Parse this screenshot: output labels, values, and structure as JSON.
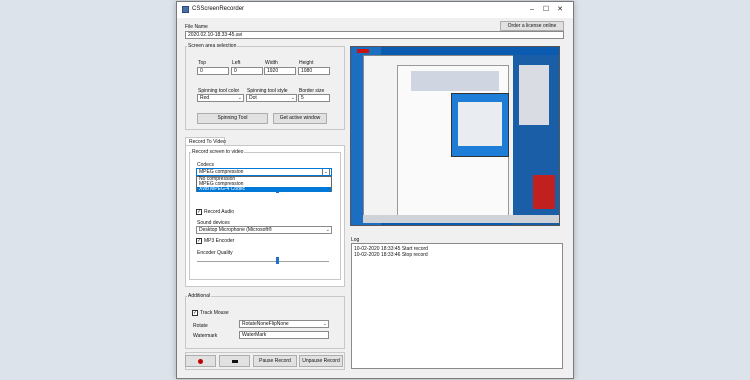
{
  "window": {
    "title": "CSScreenRecorder",
    "controls": {
      "minimize": "–",
      "maximize": "☐",
      "close": "✕"
    }
  },
  "file_name": {
    "label": "File Name",
    "value": "2020.02.10-18.33-45.avi",
    "order_button": "Order a license online"
  },
  "screen_area": {
    "group_label": "Screen area selection",
    "top_label": "Top",
    "top_value": "0",
    "left_label": "Left",
    "left_value": "0",
    "width_label": "Width",
    "width_value": "1920",
    "height_label": "Height",
    "height_value": "1080",
    "spin_color_label": "Spinning tool color",
    "spin_color_value": "Red",
    "spin_style_label": "Spinning tool style",
    "spin_style_value": "Dot",
    "border_label": "Border size",
    "border_value": "5",
    "spin_button": "Spinning Tool",
    "active_window_button": "Get active window"
  },
  "tab": {
    "label": "Record To Video"
  },
  "record_video": {
    "group_label": "Record screen to video",
    "codecs_label": "Codecs",
    "codec_selected": "MPEG compression",
    "codec_options": [
      "No compression",
      "MPEG compression",
      "Xvid MPEG-4 Codec"
    ],
    "record_audio_label": "Record Audio",
    "record_audio_checked": true,
    "sound_devices_label": "Sound devices",
    "sound_device_value": "Desktop Microphone (Microsoft®",
    "mp3_label": "MP3 Encoder",
    "mp3_checked": true,
    "encoder_quality_label": "Encoder Quality",
    "encoder_quality_fraction": 0.6,
    "hidden_slider_fraction": 0.6
  },
  "log": {
    "label": "Log",
    "lines": [
      "10-02-2020 18:33:45 Start record",
      "10-02-2020 18:33:46 Stop record"
    ]
  },
  "additional": {
    "group_label": "Additional",
    "track_mouse_label": "Track Mouse",
    "track_mouse_checked": true,
    "rotate_label": "Rotate",
    "rotate_value": "RotateNoneFlipNone",
    "watermark_label": "Watermark",
    "watermark_value": "WaterMark"
  },
  "bottom_buttons": {
    "record_icon": "record-icon",
    "stop_icon": "stop-icon",
    "pause": "Pause Record",
    "unpause": "Unpause Record"
  },
  "colors": {
    "selection_blue": "#0078d7",
    "thumb_blue": "#1f6fd0",
    "record_red": "#c00000"
  }
}
